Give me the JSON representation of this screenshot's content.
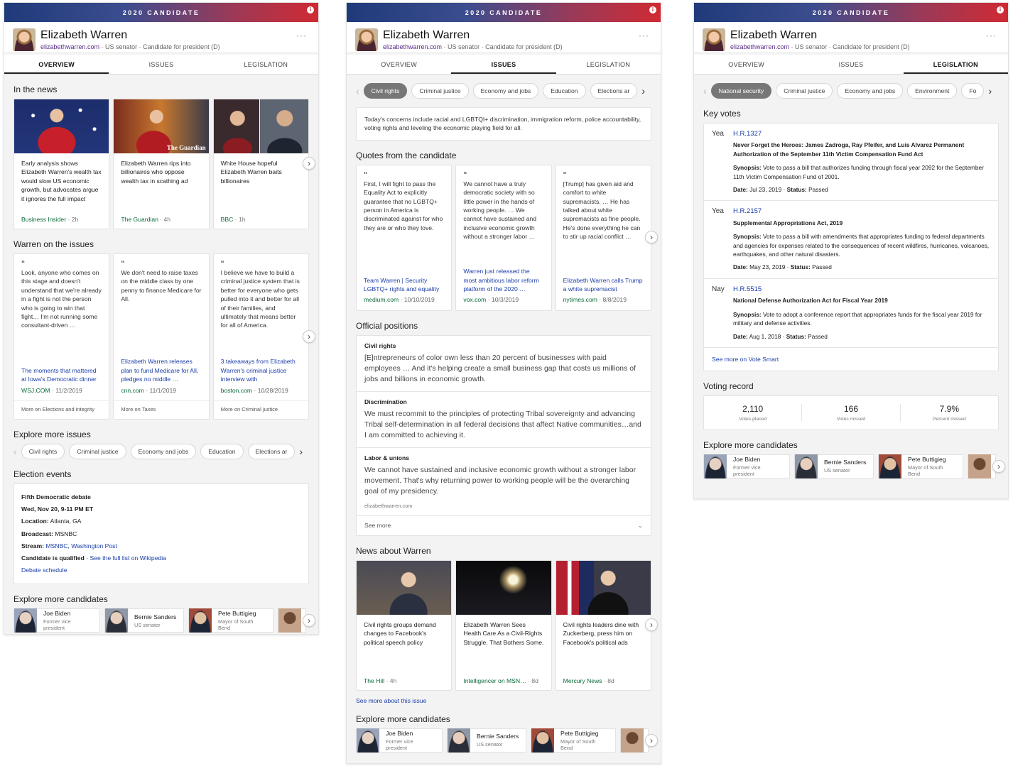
{
  "banner": "2020 CANDIDATE",
  "name": "Elizabeth Warren",
  "site": "elizabethwarren.com",
  "role1": "US senator",
  "role2": "Candidate for president (D)",
  "more": "···",
  "tabs": [
    "OVERVIEW",
    "ISSUES",
    "LEGISLATION"
  ],
  "p1": {
    "news_title": "In the news",
    "news": [
      {
        "text": "Early analysis shows Elizabeth Warren's wealth tax would slow US economic growth, but advocates argue it ignores the full impact",
        "source": "Business Insider",
        "time": "2h"
      },
      {
        "text": "Elizabeth Warren rips into billionaires who oppose wealth tax in scathing ad",
        "source": "The Guardian",
        "time": "4h"
      },
      {
        "text": "White House hopeful Elizabeth Warren baits billionaires",
        "source": "BBC",
        "time": "1h"
      }
    ],
    "issues_title": "Warren on the issues",
    "issues": [
      {
        "quote": "Look, anyone who comes on this stage and doesn't understand that we're already in a fight is not the person who is going to win that fight… I'm not running some consultant-driven …",
        "link": "The moments that mattered at Iowa's Democratic dinner",
        "source": "WSJ.COM",
        "date": "11/2/2019",
        "more": "More on Elections and integrity"
      },
      {
        "quote": "We don't need to raise taxes on the middle class by one penny to finance Medicare for All.",
        "link": "Elizabeth Warren releases plan to fund Medicare for All, pledges no middle …",
        "source": "cnn.com",
        "date": "11/1/2019",
        "more": "More on Taxes"
      },
      {
        "quote": "I believe we have to build a criminal justice system that is better for everyone who gets pulled into it and better for all of their families, and ultimately that means better for all of America.",
        "link": "3 takeaways from Elizabeth Warren's criminal justice interview with",
        "source": "boston.com",
        "date": "10/28/2019",
        "more": "More on Criminal justice"
      }
    ],
    "explore_title": "Explore more issues",
    "chips": [
      "Civil rights",
      "Criminal justice",
      "Economy and jobs",
      "Education",
      "Elections ar"
    ],
    "events_title": "Election events",
    "event": {
      "title": "Fifth Democratic debate",
      "when": "Wed, Nov 20, 9-11 PM ET",
      "loc_label": "Location:",
      "loc": "Atlanta, GA",
      "bc_label": "Broadcast:",
      "bc": "MSNBC",
      "st_label": "Stream:",
      "st": "MSNBC, Washington Post",
      "q_label": "Candidate is qualified",
      "q_link": "See the full list on Wikipedia",
      "sched": "Debate schedule"
    },
    "cands_title": "Explore more candidates"
  },
  "cands": [
    {
      "name": "Joe Biden",
      "role": "Former vice president"
    },
    {
      "name": "Bernie Sanders",
      "role": "US senator"
    },
    {
      "name": "Pete Buttigieg",
      "role": "Mayor of South Bend"
    }
  ],
  "p2": {
    "chips": [
      "Civil rights",
      "Criminal justice",
      "Economy and jobs",
      "Education",
      "Elections ar"
    ],
    "intro": "Today's concerns include racial and LGBTQI+ discrimination, immigration reform, police accountability, voting rights and leveling the economic playing field for all.",
    "quotes_title": "Quotes from the candidate",
    "quotes": [
      {
        "quote": "First, I will fight to pass the Equality Act to explicitly guarantee that no LGBTQ+ person in America is discriminated against for who they are or who they love.",
        "link": "Team Warren | Security LGBTQ+ rights and equality",
        "source": "medium.com",
        "date": "10/10/2019"
      },
      {
        "quote": "We cannot have a truly democratic society with so little power in the hands of working people. … We cannot have sustained and inclusive economic growth without a stronger labor …",
        "link": "Warren just released the most ambitious labor reform platform of the 2020 …",
        "source": "vox.com",
        "date": "10/3/2019"
      },
      {
        "quote": "[Trump] has given aid and comfort to white supremacists. … He has talked about white supremacists as fine people. He's done everything he can to stir up racial conflict …",
        "link": "Elizabeth Warren calls Trump a white supremacist",
        "source": "nytimes.com",
        "date": "8/8/2019"
      }
    ],
    "pos_title": "Official positions",
    "positions": [
      {
        "h": "Civil rights",
        "t": "[E]ntrepreneurs of color own less than 20 percent of businesses with paid employees … And it's helping create a small business gap that costs us millions of jobs and billions in economic growth."
      },
      {
        "h": "Discrimination",
        "t": "We must recommit to the principles of protecting Tribal sovereignty and advancing Tribal self-determination in all federal decisions that affect Native communities…and I am committed to achieving it."
      },
      {
        "h": "Labor & unions",
        "t": "We cannot have sustained and inclusive economic growth without a stronger labor movement. That's why returning power to working people will be the overarching goal of my presidency."
      }
    ],
    "pos_src": "elizabethwarren.com",
    "see_more": "See more",
    "news_title": "News about Warren",
    "news": [
      {
        "text": "Civil rights groups demand changes to Facebook's political speech policy",
        "source": "The Hill",
        "time": "4h"
      },
      {
        "text": "Elizabeth Warren Sees Health Care As a Civil-Rights Struggle. That Bothers Some.",
        "source": "Intelligencer on MSN…",
        "time": "8d"
      },
      {
        "text": "Civil rights leaders dine with Zuckerberg, press him on Facebook's political ads",
        "source": "Mercury News",
        "time": "8d"
      }
    ],
    "see_issue": "See more about this issue",
    "cands_title": "Explore more candidates"
  },
  "p3": {
    "chips": [
      "National security",
      "Criminal justice",
      "Economy and jobs",
      "Environment",
      "Fo"
    ],
    "votes_title": "Key votes",
    "votes": [
      {
        "vote": "Yea",
        "bill": "H.R.1327",
        "title": "Never Forget the Heroes: James Zadroga, Ray Pfeifer, and Luis Alvarez Permanent Authorization of the September 11th Victim Compensation Fund Act",
        "syn": "Vote to pass a bill that authorizes funding through fiscal year 2092 for the September 11th Victim Compensation Fund of 2001.",
        "date": "Jul 23, 2019",
        "status": "Passed"
      },
      {
        "vote": "Yea",
        "bill": "H.R.2157",
        "title": "Supplemental Appropriations Act, 2019",
        "syn": "Vote to pass a bill with amendments that appropriates funding to federal departments and agencies for expenses related to the consequences of recent wildfires, hurricanes, volcanoes, earthquakes, and other natural disasters.",
        "date": "May 23, 2019",
        "status": "Passed"
      },
      {
        "vote": "Nay",
        "bill": "H.R.5515",
        "title": "National Defense Authorization Act for Fiscal Year 2019",
        "syn": "Vote to adopt a conference report that appropriates funds for the fiscal year 2019 for military and defense activities.",
        "date": "Aug 1, 2018",
        "status": "Passed"
      }
    ],
    "syn_label": "Synopsis:",
    "date_label": "Date:",
    "status_label": "Status:",
    "vote_smart": "See more on Vote Smart",
    "record_title": "Voting record",
    "stats": [
      {
        "v": "2,110",
        "l": "Votes placed"
      },
      {
        "v": "166",
        "l": "Votes missed"
      },
      {
        "v": "7.9%",
        "l": "Percent missed"
      }
    ],
    "cands_title": "Explore more candidates"
  }
}
